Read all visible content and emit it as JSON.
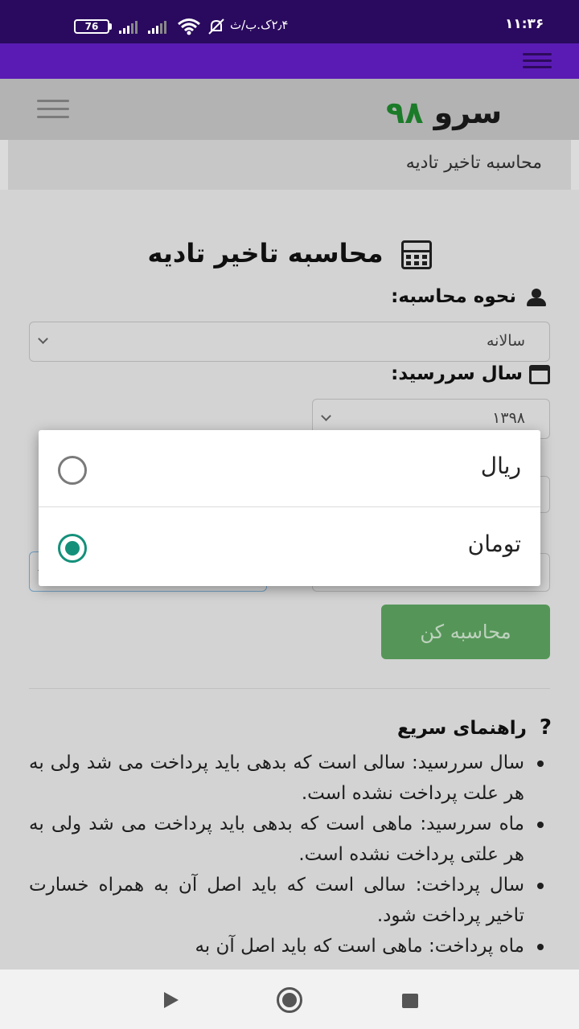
{
  "status_bar": {
    "time": "۱۱:۳۶",
    "network_speed": "۲٫۴ک.ب/ث",
    "battery_level": "76",
    "icons": [
      "notifications-off-icon",
      "wifi-icon",
      "signal-icon",
      "signal-icon",
      "battery-icon"
    ]
  },
  "browser": {
    "menu_icon": "hamburger-icon"
  },
  "header": {
    "logo_word": "سرو",
    "logo_number": "۹۸",
    "menu_icon": "hamburger-icon"
  },
  "breadcrumb": {
    "text": "محاسبه تاخیر تادیه"
  },
  "form": {
    "title": "محاسبه تاخیر تادیه",
    "method_label": "نحوه محاسبه:",
    "method_value": "سالانه",
    "due_year_label": "سال سررسید:",
    "due_year_value": "۱۳۹۸",
    "submit_label": "محاسبه کن"
  },
  "help": {
    "title": "راهنمای سریع",
    "icon": "?",
    "items": [
      "سال سررسید: سالی است که بدهی باید پرداخت می شد ولی به هر علت پرداخت نشده است.",
      "ماه سررسید: ماهی است که بدهی باید پرداخت می شد ولی به هر علتی پرداخت نشده است.",
      "سال پرداخت: سالی است که باید اصل آن به همراه خسارت تاخیر پرداخت شود.",
      "ماه پرداخت: ماهی است که باید اصل آن به"
    ]
  },
  "currency_dialog": {
    "options": [
      {
        "label": "ریال",
        "selected": false
      },
      {
        "label": "تومان",
        "selected": true
      }
    ],
    "accent_color": "#14907a"
  },
  "colors": {
    "status_bar": "#2a0a5e",
    "browser_bar": "#5a1bb4",
    "logo_number": "#1f8a2e",
    "submit_button": "#5fa862"
  }
}
